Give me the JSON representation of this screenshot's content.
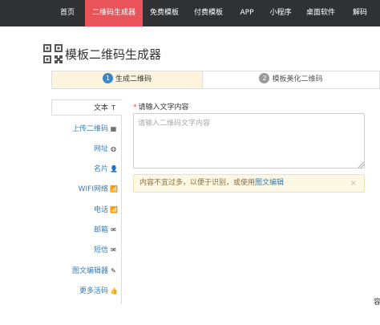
{
  "nav": {
    "items": [
      {
        "label": "首页"
      },
      {
        "label": "二维码生成器"
      },
      {
        "label": "免费模板"
      },
      {
        "label": "付费模板"
      },
      {
        "label": "APP"
      },
      {
        "label": "小程序"
      },
      {
        "label": "桌面软件"
      },
      {
        "label": "解码"
      }
    ]
  },
  "page": {
    "title": "模板二维码生成器"
  },
  "steps": [
    {
      "num": "1",
      "label": "生成二维码"
    },
    {
      "num": "2",
      "label": "模板美化二维码"
    }
  ],
  "sidebar": {
    "items": [
      {
        "label": "文本",
        "icon": "T"
      },
      {
        "label": "上传二维码",
        "icon": "▦"
      },
      {
        "label": "网址",
        "icon": "◍"
      },
      {
        "label": "名片",
        "icon": "👤"
      },
      {
        "label": "WIFI网络",
        "icon": "📶"
      },
      {
        "label": "电话",
        "icon": "📶"
      },
      {
        "label": "邮箱",
        "icon": "✉"
      },
      {
        "label": "短信",
        "icon": "✉"
      },
      {
        "label": "图文编辑器",
        "icon": "✎"
      },
      {
        "label": "更多活码",
        "icon": "👍"
      }
    ]
  },
  "form": {
    "label": "请输入文字内容",
    "required_mark": "*",
    "placeholder": "请输入二维码文字内容",
    "value": ""
  },
  "alert": {
    "text": "内容不宜过多，以便于识别，或使用",
    "link": "图文编辑",
    "close": "×"
  },
  "edge_text": "容",
  "colors": {
    "topbar": "#2f3133",
    "nav_active": "#e8545a",
    "link": "#3a7bb0",
    "step_active_bg": "#fcf4dc",
    "alert_bg": "#fcf8e3"
  }
}
